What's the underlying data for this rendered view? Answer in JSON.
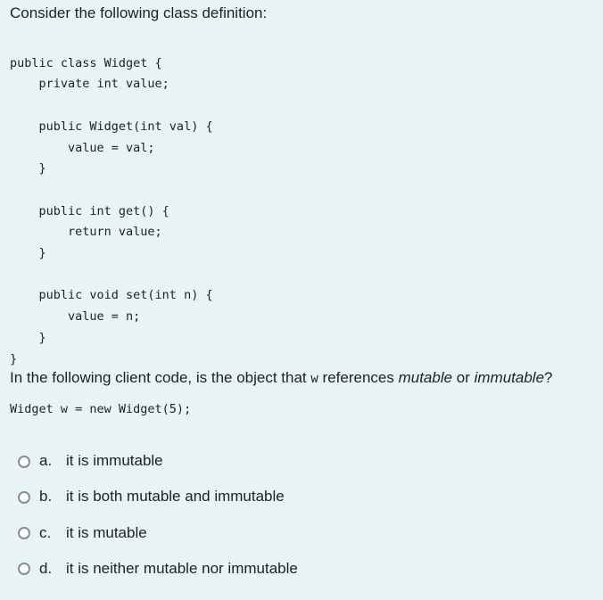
{
  "question": {
    "intro": "Consider the following class definition:",
    "class_code": [
      "public class Widget {",
      "    private int value;",
      "",
      "    public Widget(int val) {",
      "        value = val;",
      "    }",
      "",
      "    public int get() {",
      "        return value;",
      "    }",
      "",
      "    public void set(int n) {",
      "        value = n;",
      "    }",
      "}"
    ],
    "prompt_before": "In the following client code, is the object that ",
    "prompt_code": "w",
    "prompt_middle": " references ",
    "prompt_em1": "mutable",
    "prompt_or": " or ",
    "prompt_em2": "immutable",
    "prompt_end": "?",
    "client_code": "Widget w = new Widget(5);"
  },
  "options": [
    {
      "letter": "a.",
      "label": "it is immutable",
      "selected": false
    },
    {
      "letter": "b.",
      "label": "it is both mutable and immutable",
      "selected": false
    },
    {
      "letter": "c.",
      "label": "it is mutable",
      "selected": false
    },
    {
      "letter": "d.",
      "label": "it is neither mutable nor immutable",
      "selected": false
    }
  ]
}
